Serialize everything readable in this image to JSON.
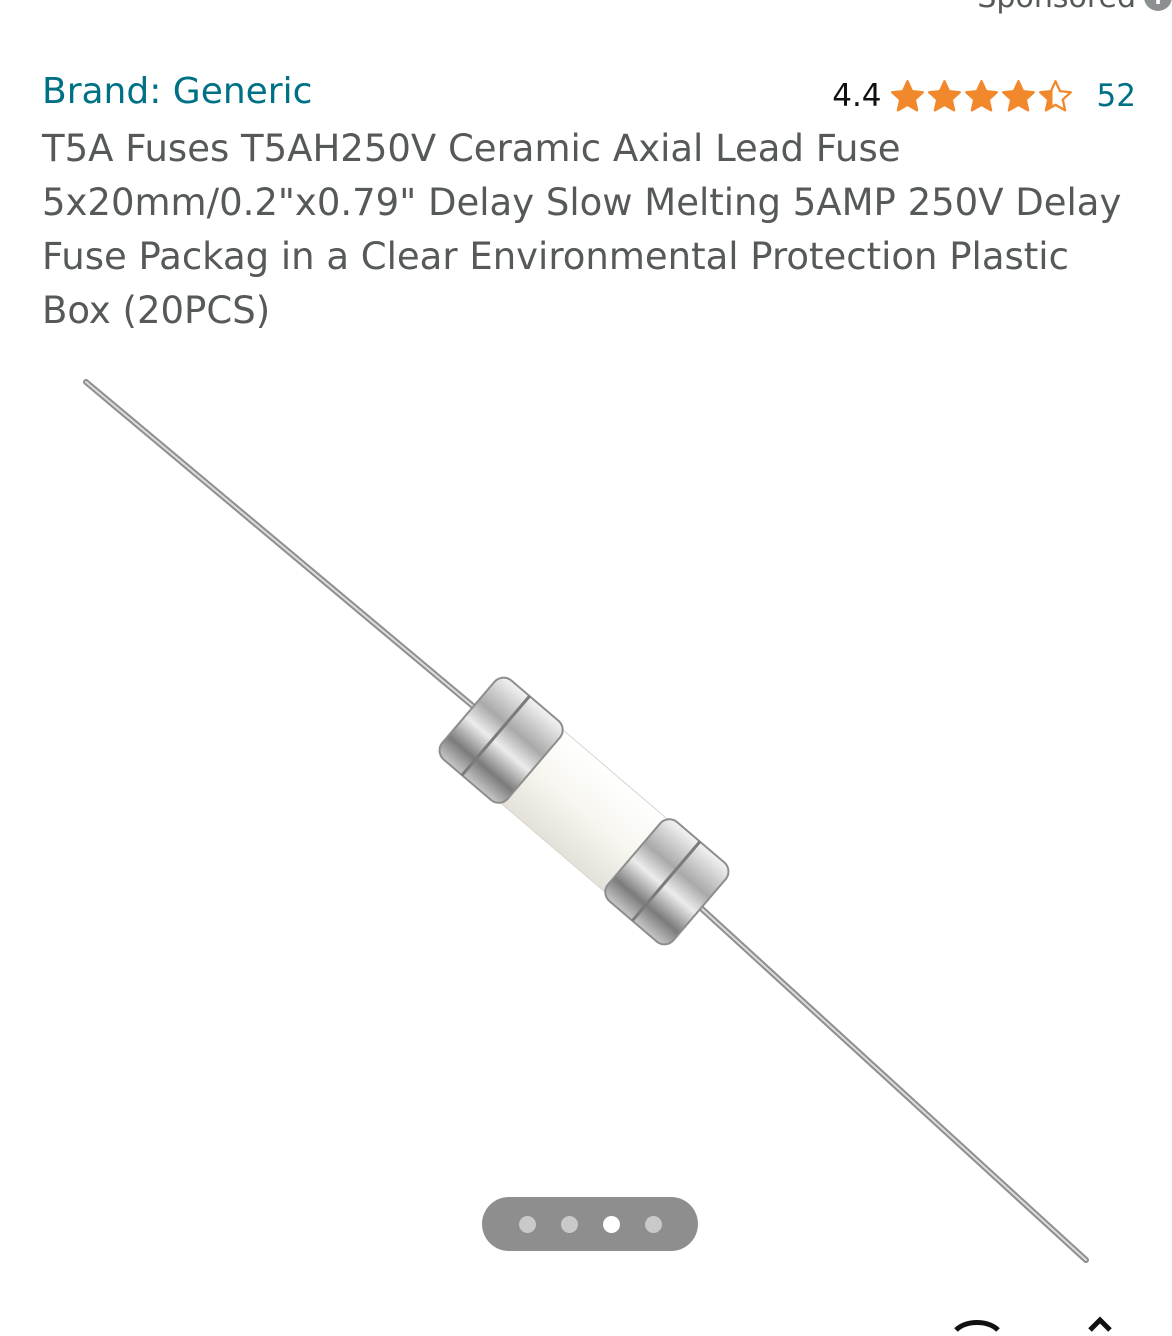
{
  "header": {
    "sponsored_label": "Sponsored",
    "info_icon": "info-icon"
  },
  "product": {
    "brand": "Brand: Generic",
    "rating_value": "4.4",
    "rating_stars": 4.4,
    "review_count": "52",
    "title": "T5A Fuses T5AH250V Ceramic Axial Lead Fuse 5x20mm/0.2\"x0.79\" Delay Slow Melting 5AMP 250V Delay Fuse Packag in a Clear Environmental Protection Plastic Box (20PCS)"
  },
  "gallery": {
    "image_subject": "fuse-image",
    "page_count": 4,
    "active_index": 2
  },
  "colors": {
    "link": "#007185",
    "star": "#f1882b",
    "text_secondary": "#565959",
    "text_primary": "#0f1111",
    "carousel_bg": "#8e8e8e"
  }
}
